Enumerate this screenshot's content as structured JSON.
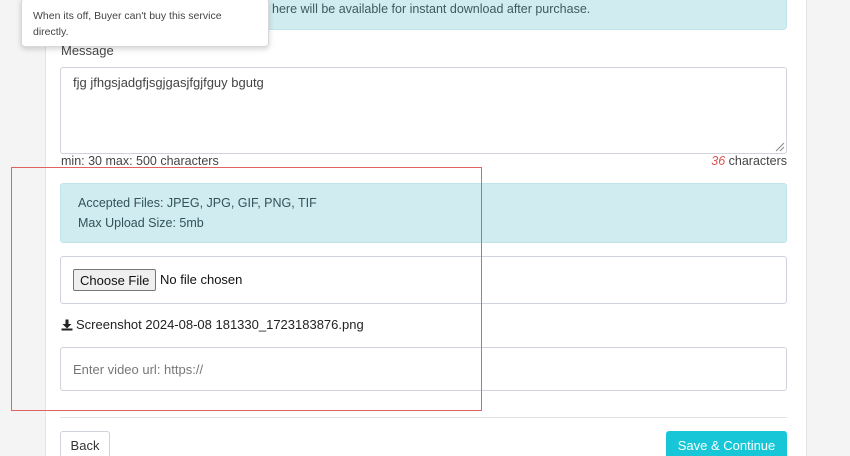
{
  "top_alert": {
    "text": "here will be available for instant download after purchase."
  },
  "tooltip": {
    "text": "When its off, Buyer can't buy this service directly."
  },
  "message": {
    "label": "Message",
    "value": "fjg jfhgsjadgfjsgjgasjfgjfguy bgutg",
    "limits": "min: 30 max: 500 characters",
    "char_count": "36",
    "char_suffix": "characters"
  },
  "upload_info": {
    "accepted": "Accepted Files: JPEG, JPG, GIF, PNG, TIF",
    "max_size": "Max Upload Size: 5mb"
  },
  "file_input": {
    "button_label": "Choose File",
    "status": "No file chosen"
  },
  "uploaded_file": {
    "icon": "download-icon",
    "name": "Screenshot 2024-08-08 181330_1723183876.png"
  },
  "video_url": {
    "placeholder": "Enter video url: https://"
  },
  "footer": {
    "back_label": "Back",
    "save_label": "Save & Continue"
  },
  "colors": {
    "info_bg": "#d1ecf1",
    "accent": "#17c7d7",
    "highlight": "#e06262",
    "count": "#d9534f"
  }
}
